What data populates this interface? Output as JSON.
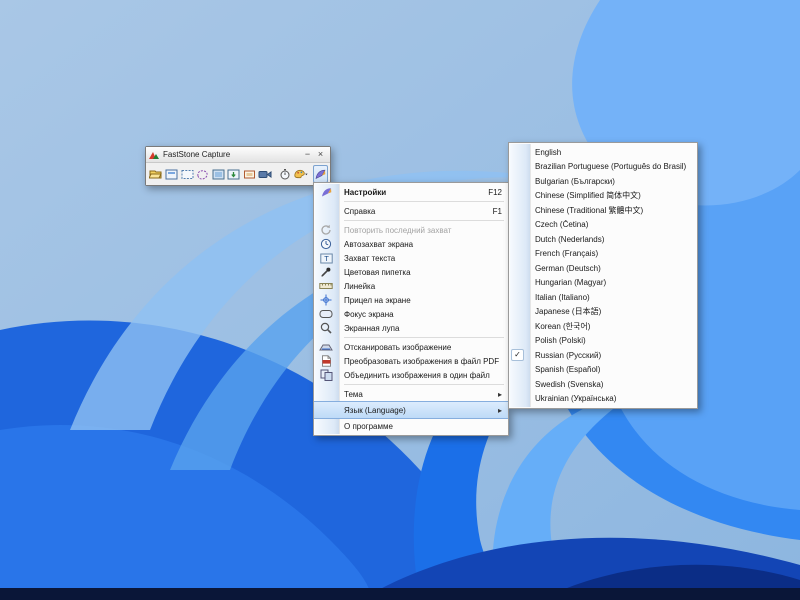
{
  "window": {
    "title": "FastStone Capture",
    "controls": {
      "minimize": "−",
      "close": "×"
    },
    "toolbar_icons": [
      "open-file-icon",
      "capture-window-icon",
      "capture-rectangle-icon",
      "capture-freehand-icon",
      "capture-fullscreen-icon",
      "capture-scrolling-icon",
      "capture-fixed-region-icon",
      "screen-recorder-icon",
      "delay-timer-icon",
      "draw-settings-icon",
      "app-menu-icon"
    ]
  },
  "menu": {
    "items": [
      {
        "label": "Настройки",
        "hotkey": "F12",
        "icon": "faststone-wing-icon",
        "bold": true
      },
      {
        "label": "Справка",
        "hotkey": "F1"
      },
      {
        "label": "Повторить последний захват",
        "icon": "repeat-icon",
        "disabled": true
      },
      {
        "label": "Автозахват экрана",
        "icon": "clock-icon"
      },
      {
        "label": "Захват текста",
        "icon": "text-capture-icon"
      },
      {
        "label": "Цветовая пипетка",
        "icon": "eyedropper-icon"
      },
      {
        "label": "Линейка",
        "icon": "ruler-icon"
      },
      {
        "label": "Прицел на экране",
        "icon": "crosshair-icon"
      },
      {
        "label": "Фокус экрана",
        "icon": "focus-rect-icon"
      },
      {
        "label": "Экранная лупа",
        "icon": "magnifier-icon"
      },
      {
        "label": "Отсканировать изображение",
        "icon": "scanner-icon"
      },
      {
        "label": "Преобразовать изображения в файл PDF",
        "icon": "pdf-icon"
      },
      {
        "label": "Объединить изображения в один файл",
        "icon": "merge-icon"
      },
      {
        "label": "Тема",
        "has_submenu": true
      },
      {
        "label": "Язык (Language)",
        "has_submenu": true,
        "highlighted": true
      },
      {
        "label": "О программе"
      }
    ]
  },
  "submenu": {
    "items": [
      {
        "label": "English"
      },
      {
        "label": "Brazilian Portuguese (Português do Brasil)"
      },
      {
        "label": "Bulgarian (Български)"
      },
      {
        "label": "Chinese (Simplified 简体中文)"
      },
      {
        "label": "Chinese (Traditional 繁體中文)"
      },
      {
        "label": "Czech (Četina)"
      },
      {
        "label": "Dutch (Nederlands)"
      },
      {
        "label": "French (Français)"
      },
      {
        "label": "German (Deutsch)"
      },
      {
        "label": "Hungarian (Magyar)"
      },
      {
        "label": "Italian (Italiano)"
      },
      {
        "label": "Japanese (日本語)"
      },
      {
        "label": "Korean (한국어)"
      },
      {
        "label": "Polish (Polski)"
      },
      {
        "label": "Russian (Русский)",
        "checked": true
      },
      {
        "label": "Spanish (Español)"
      },
      {
        "label": "Swedish (Svenska)"
      },
      {
        "label": "Ukrainian (Українська)"
      }
    ]
  },
  "colors": {
    "menu_highlight": "#bedaf7",
    "menu_highlight_border": "#86aede",
    "wallpaper_base": "#9dbfe2",
    "wallpaper_accent": "#2f84f0",
    "wallpaper_dark": "#0a1638"
  }
}
